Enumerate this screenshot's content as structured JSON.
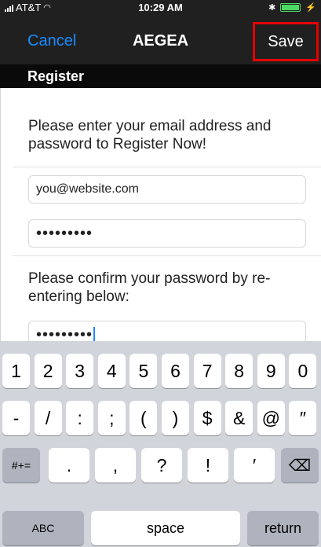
{
  "status_bar": {
    "carrier": "AT&T",
    "time": "10:29 AM",
    "bluetooth_icon": "bluetooth-icon",
    "battery_icon": "battery-charging-icon"
  },
  "nav": {
    "cancel_label": "Cancel",
    "title": "AEGEA",
    "save_label": "Save"
  },
  "section_header": "Register",
  "form": {
    "prompt_1": "Please enter your email address and password to Register Now!",
    "email_value": "you@website.com",
    "password_value": "•••••••••",
    "prompt_2": "Please confirm your password by re-entering below:",
    "confirm_value": "•••••••••"
  },
  "keyboard": {
    "row1": [
      "1",
      "2",
      "3",
      "4",
      "5",
      "6",
      "7",
      "8",
      "9",
      "0"
    ],
    "row2": [
      "-",
      "/",
      ":",
      ";",
      "(",
      ")",
      "$",
      "&",
      "@",
      "″"
    ],
    "row3": {
      "symbols": "#+=",
      "keys": [
        ".",
        ",",
        "?",
        "!",
        "′"
      ],
      "delete_icon": "backspace-icon"
    },
    "row4": {
      "abc": "ABC",
      "space": "space",
      "return": "return"
    }
  },
  "colors": {
    "accent": "#1a8cff",
    "highlight": "#e60000",
    "battery": "#4cd964"
  }
}
